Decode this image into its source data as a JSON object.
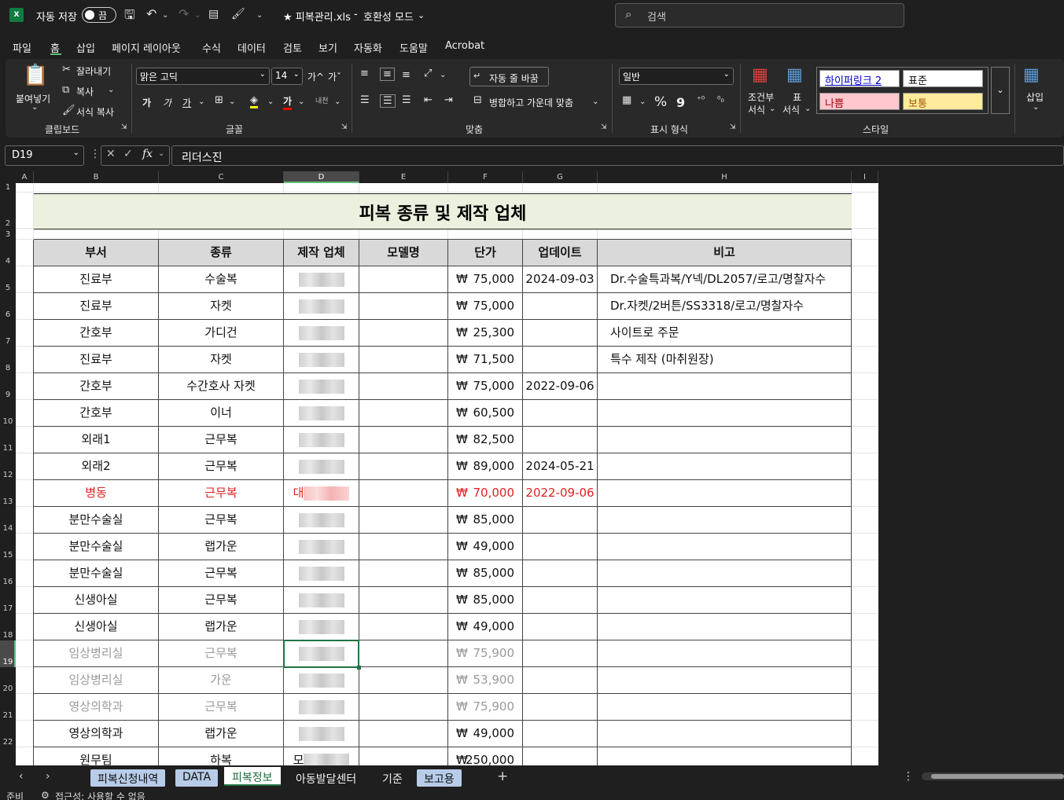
{
  "window": {
    "autosave_label": "자동 저장",
    "autosave_state": "끔",
    "file_title": "★ 피복관리.xls",
    "separator": "-",
    "mode": "호환성 모드",
    "search_placeholder": "검색"
  },
  "menu": [
    "파일",
    "홈",
    "삽입",
    "페이지 레이아웃",
    "수식",
    "데이터",
    "검토",
    "보기",
    "자동화",
    "도움말",
    "Acrobat"
  ],
  "ribbon": {
    "clipboard": {
      "paste": "붙여넣기",
      "cut": "잘라내기",
      "copy": "복사",
      "format_painter": "서식 복사",
      "label": "클립보드"
    },
    "font": {
      "name": "맑은 고딕",
      "size": "14",
      "label": "글꼴",
      "grow": "가^",
      "shrink": "가ˇ",
      "bold": "가",
      "italic": "가",
      "underline": "가",
      "color": "가",
      "phonetic": "내천"
    },
    "align": {
      "wrap": "자동 줄 바꿈",
      "merge": "병합하고 가운데 맞춤",
      "label": "맞춤"
    },
    "number": {
      "format": "일반",
      "label": "표시 형식",
      "percent": "%",
      "comma": "9"
    },
    "styles": {
      "conditional_1": "조건부",
      "conditional_2": "서식",
      "table_1": "표",
      "table_2": "서식",
      "hyperlink2": "하이퍼링크 2",
      "normal": "표준",
      "bad": "나쁨",
      "neutral": "보통",
      "label": "스타일"
    },
    "cells": {
      "insert": "삽입"
    }
  },
  "formula_bar": {
    "name_box": "D19",
    "fx": "fx",
    "value": "리더스진"
  },
  "columns": [
    "A",
    "B",
    "C",
    "D",
    "E",
    "F",
    "G",
    "H",
    "I"
  ],
  "rows": [
    "1",
    "2",
    "3",
    "4",
    "5",
    "6",
    "7",
    "8",
    "9",
    "10",
    "11",
    "12",
    "13",
    "14",
    "15",
    "16",
    "17",
    "18",
    "19",
    "20",
    "21",
    "22"
  ],
  "sheet": {
    "title": "피복 종류 및 제작 업체",
    "headers": {
      "dept": "부서",
      "type": "종류",
      "maker": "제작 업체",
      "model": "모델명",
      "price": "단가",
      "updated": "업데이트",
      "note": "비고"
    },
    "currency": "₩",
    "rows": [
      {
        "dept": "진료부",
        "type": "수술복",
        "maker_prefix": "",
        "price": "75,000",
        "updated": "2024-09-03",
        "note": "Dr.수술특과복/Y넥/DL2057/로고/명찰자수",
        "style": ""
      },
      {
        "dept": "진료부",
        "type": "자켓",
        "maker_prefix": "",
        "price": "75,000",
        "updated": "",
        "note": "Dr.자켓/2버튼/SS3318/로고/명찰자수",
        "style": ""
      },
      {
        "dept": "간호부",
        "type": "가디건",
        "maker_prefix": "",
        "price": "25,300",
        "updated": "",
        "note": "사이트로 주문",
        "style": ""
      },
      {
        "dept": "진료부",
        "type": "자켓",
        "maker_prefix": "",
        "price": "71,500",
        "updated": "",
        "note": "특수 제작 (마취원장)",
        "style": ""
      },
      {
        "dept": "간호부",
        "type": "수간호사 자켓",
        "maker_prefix": "",
        "price": "75,000",
        "updated": "2022-09-06",
        "note": "",
        "style": ""
      },
      {
        "dept": "간호부",
        "type": "이너",
        "maker_prefix": "",
        "price": "60,500",
        "updated": "",
        "note": "",
        "style": ""
      },
      {
        "dept": "외래1",
        "type": "근무복",
        "maker_prefix": "",
        "price": "82,500",
        "updated": "",
        "note": "",
        "style": ""
      },
      {
        "dept": "외래2",
        "type": "근무복",
        "maker_prefix": "",
        "price": "89,000",
        "updated": "2024-05-21",
        "note": "",
        "style": ""
      },
      {
        "dept": "병동",
        "type": "근무복",
        "maker_prefix": "대",
        "price": "70,000",
        "updated": "2022-09-06",
        "note": "",
        "style": "red"
      },
      {
        "dept": "분만수술실",
        "type": "근무복",
        "maker_prefix": "",
        "price": "85,000",
        "updated": "",
        "note": "",
        "style": ""
      },
      {
        "dept": "분만수술실",
        "type": "랩가운",
        "maker_prefix": "",
        "price": "49,000",
        "updated": "",
        "note": "",
        "style": ""
      },
      {
        "dept": "분만수술실",
        "type": "근무복",
        "maker_prefix": "",
        "price": "85,000",
        "updated": "",
        "note": "",
        "style": ""
      },
      {
        "dept": "신생아실",
        "type": "근무복",
        "maker_prefix": "",
        "price": "85,000",
        "updated": "",
        "note": "",
        "style": ""
      },
      {
        "dept": "신생아실",
        "type": "랩가운",
        "maker_prefix": "",
        "price": "49,000",
        "updated": "",
        "note": "",
        "style": ""
      },
      {
        "dept": "임상병리실",
        "type": "근무복",
        "maker_prefix": "",
        "price": "75,900",
        "updated": "",
        "note": "",
        "style": "grey"
      },
      {
        "dept": "임상병리실",
        "type": "가운",
        "maker_prefix": "",
        "price": "53,900",
        "updated": "",
        "note": "",
        "style": "grey"
      },
      {
        "dept": "영상의학과",
        "type": "근무복",
        "maker_prefix": "",
        "price": "75,900",
        "updated": "",
        "note": "",
        "style": "grey"
      },
      {
        "dept": "영상의학과",
        "type": "랩가운",
        "maker_prefix": "",
        "price": "49,000",
        "updated": "",
        "note": "",
        "style": ""
      },
      {
        "dept": "원무팀",
        "type": "하복",
        "maker_prefix": "모",
        "price": "250,000",
        "updated": "",
        "note": "",
        "style": ""
      }
    ]
  },
  "tabs": [
    {
      "label": "피복신청내역",
      "kind": "colored"
    },
    {
      "label": "DATA",
      "kind": "colored"
    },
    {
      "label": "피복정보",
      "kind": "active"
    },
    {
      "label": "아동발달센터",
      "kind": "plain"
    },
    {
      "label": "기준",
      "kind": "plain"
    },
    {
      "label": "보고용",
      "kind": "colored"
    }
  ],
  "status": {
    "ready": "준비",
    "accessibility": "접근성: 사용할 수 없음"
  }
}
